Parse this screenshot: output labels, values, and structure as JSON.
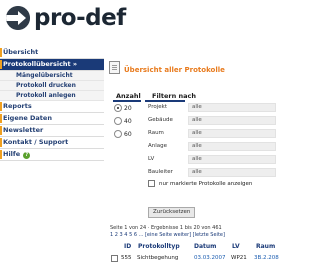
{
  "brand": {
    "logo_text": "pro-def",
    "logo_icon": "arrow-circle-icon"
  },
  "sidebar": {
    "items": [
      {
        "label": "Übersicht",
        "active": false
      },
      {
        "label": "Protokollübersicht »",
        "active": true
      },
      {
        "label": "Reports",
        "active": false
      },
      {
        "label": "Eigene Daten",
        "active": false
      },
      {
        "label": "Newsletter",
        "active": false
      },
      {
        "label": "Kontakt / Support",
        "active": false
      },
      {
        "label": "Hilfe",
        "active": false
      }
    ],
    "subitems": [
      {
        "label": "Mängelübersicht"
      },
      {
        "label": "Protokoll drucken"
      },
      {
        "label": "Protokoll anlegen"
      }
    ],
    "help_icon": "help-icon",
    "help_glyph": "?"
  },
  "main": {
    "title": "Übersicht aller Protokolle",
    "anzahl": {
      "header": "Anzahl",
      "options": [
        "20",
        "40",
        "60"
      ],
      "selected": "20"
    },
    "filter": {
      "header": "Filtern nach",
      "fields": [
        {
          "label": "Projekt",
          "value": "alle"
        },
        {
          "label": "Gebäude",
          "value": "alle"
        },
        {
          "label": "Raum",
          "value": "alle"
        },
        {
          "label": "Anlage",
          "value": "alle"
        },
        {
          "label": "LV",
          "value": "alle"
        },
        {
          "label": "Bauleiter",
          "value": "alle"
        }
      ],
      "checkbox_label": "nur markierte Protokolle anzeigen",
      "checkbox_checked": false
    },
    "reset_button": "Zurücksetzen",
    "result_info": "Seite 1 von 24 · Ergebnisse 1 bis 20 von 461",
    "pager": "1 2 3 4 5 6 ... [eine Seite weiter] [letzte Seite]",
    "table": {
      "headers": [
        "ID",
        "Protokolltyp",
        "Datum",
        "LV",
        "Raum"
      ],
      "rows": [
        {
          "id": "555",
          "typ": "Sichtbegehung",
          "datum": "03.03.2007",
          "lv": "WP21",
          "raum": "3B.2.208"
        }
      ]
    },
    "accent_color": "#1a3a78",
    "title_color": "#e87b1e"
  }
}
